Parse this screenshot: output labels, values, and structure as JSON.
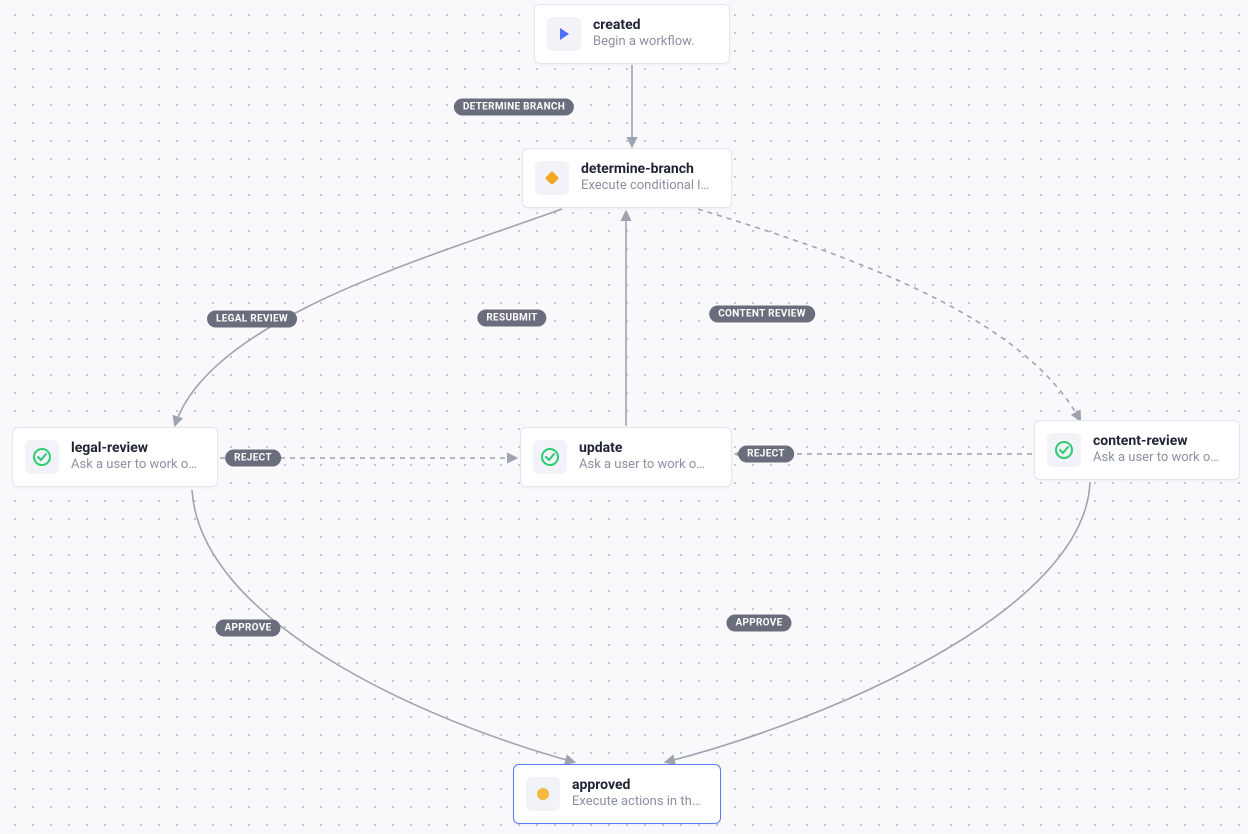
{
  "nodes": {
    "created": {
      "title": "created",
      "subtitle": "Begin a workflow."
    },
    "determineBranch": {
      "title": "determine-branch",
      "subtitle": "Execute conditional l…"
    },
    "legalReview": {
      "title": "legal-review",
      "subtitle": "Ask a user to work o…"
    },
    "update": {
      "title": "update",
      "subtitle": "Ask a user to work o…"
    },
    "contentReview": {
      "title": "content-review",
      "subtitle": "Ask a user to work o…"
    },
    "approved": {
      "title": "approved",
      "subtitle": "Execute actions in th…"
    }
  },
  "edgeLabels": {
    "determineBranch": "DETERMINE BRANCH",
    "legalReview": "LEGAL REVIEW",
    "contentReview": "CONTENT REVIEW",
    "resubmit": "RESUBMIT",
    "reject1": "REJECT",
    "reject2": "REJECT",
    "approve1": "APPROVE",
    "approve2": "APPROVE"
  },
  "colors": {
    "edge": "#9ea3b0",
    "labelBg": "#6a6e7c",
    "iconBlue": "#4c6fff",
    "iconOrange": "#f5a623",
    "iconGreen": "#2ecc71",
    "iconAmber": "#f5b942"
  }
}
